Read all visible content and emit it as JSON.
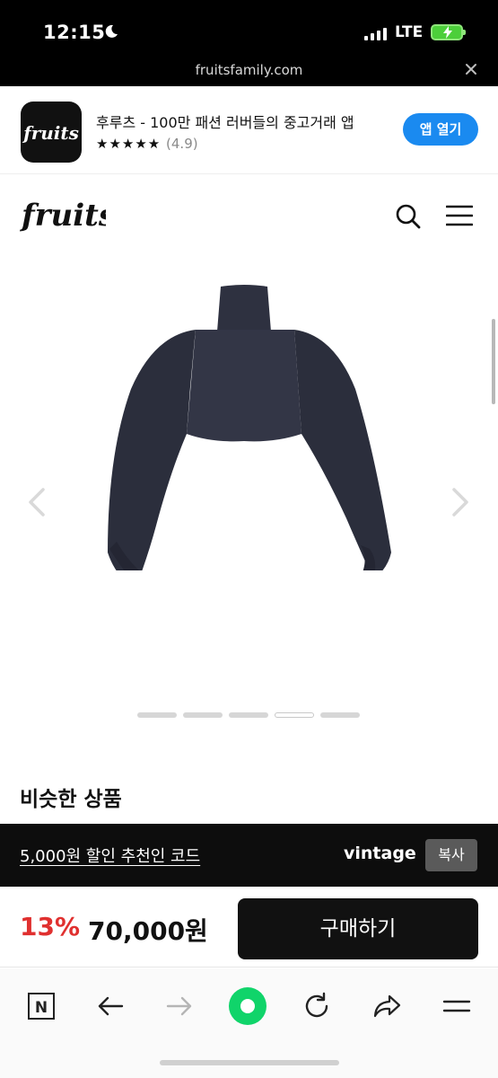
{
  "status_bar": {
    "time": "12:15",
    "network": "LTE",
    "battery_color": "#4ccf3a"
  },
  "url_bar": {
    "url": "fruitsfamily.com"
  },
  "app_banner": {
    "title": "후루츠 - 100만 패션 러버들의 중고거래 앱",
    "stars": "★★★★★",
    "rating": "(4.9)",
    "open_label": "앱 열기",
    "accent": "#1a8af0"
  },
  "header": {
    "logo_text": "fruits",
    "icons": [
      "search-icon",
      "menu-icon"
    ]
  },
  "gallery": {
    "image_count": 5,
    "active_index": 3
  },
  "similar": {
    "title": "비슷한 상품"
  },
  "promo": {
    "text": "5,000원 할인 추천인 코드",
    "code": "vintage",
    "copy_label": "복사"
  },
  "purchase": {
    "discount": "13%",
    "price": "70,000원",
    "buy_label": "구매하기",
    "discount_color": "#e0302f"
  },
  "browser_toolbar": {
    "icons": [
      "naver-icon",
      "back-icon",
      "forward-icon",
      "home-green-icon",
      "refresh-icon",
      "share-icon",
      "menu-icon"
    ]
  }
}
